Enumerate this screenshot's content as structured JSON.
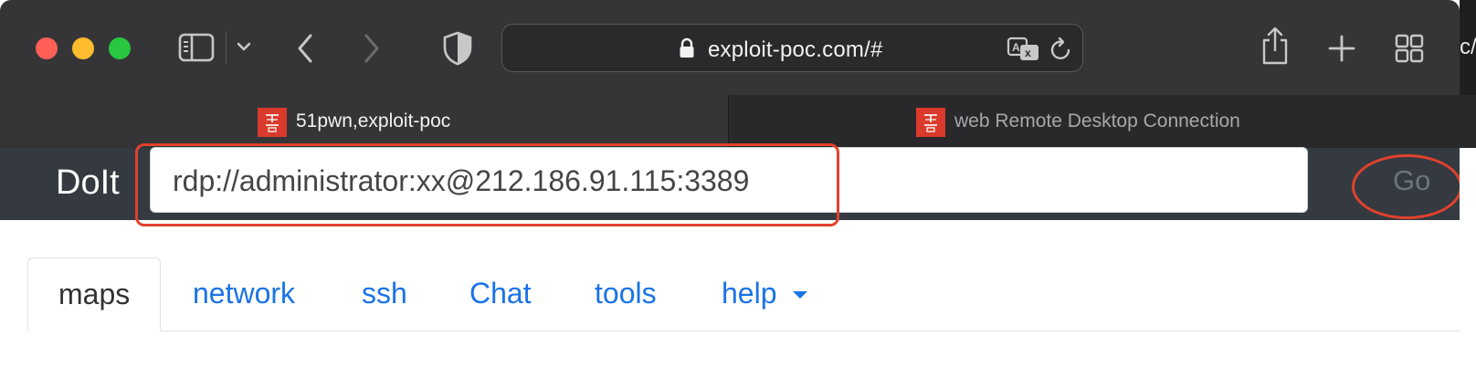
{
  "browser": {
    "address": "exploit-poc.com/#",
    "tabs": [
      {
        "title": "51pwn,exploit-poc",
        "active": true
      },
      {
        "title": "web Remote Desktop Connection",
        "active": false
      }
    ],
    "peek_text": "c/"
  },
  "navbar": {
    "brand": "DoIt",
    "command_value": "rdp://administrator:xx@212.186.91.115:3389",
    "go_label": "Go"
  },
  "nav_tabs": [
    {
      "label": "maps",
      "active": true
    },
    {
      "label": "network"
    },
    {
      "label": "ssh"
    },
    {
      "label": "Chat"
    },
    {
      "label": "tools"
    },
    {
      "label": "help",
      "dropdown": true
    }
  ],
  "colors": {
    "toolbar": "#353538",
    "navbar": "#343a40",
    "link": "#1a73e8",
    "annotation": "#e0412d",
    "favicon": "#d93a2b"
  }
}
